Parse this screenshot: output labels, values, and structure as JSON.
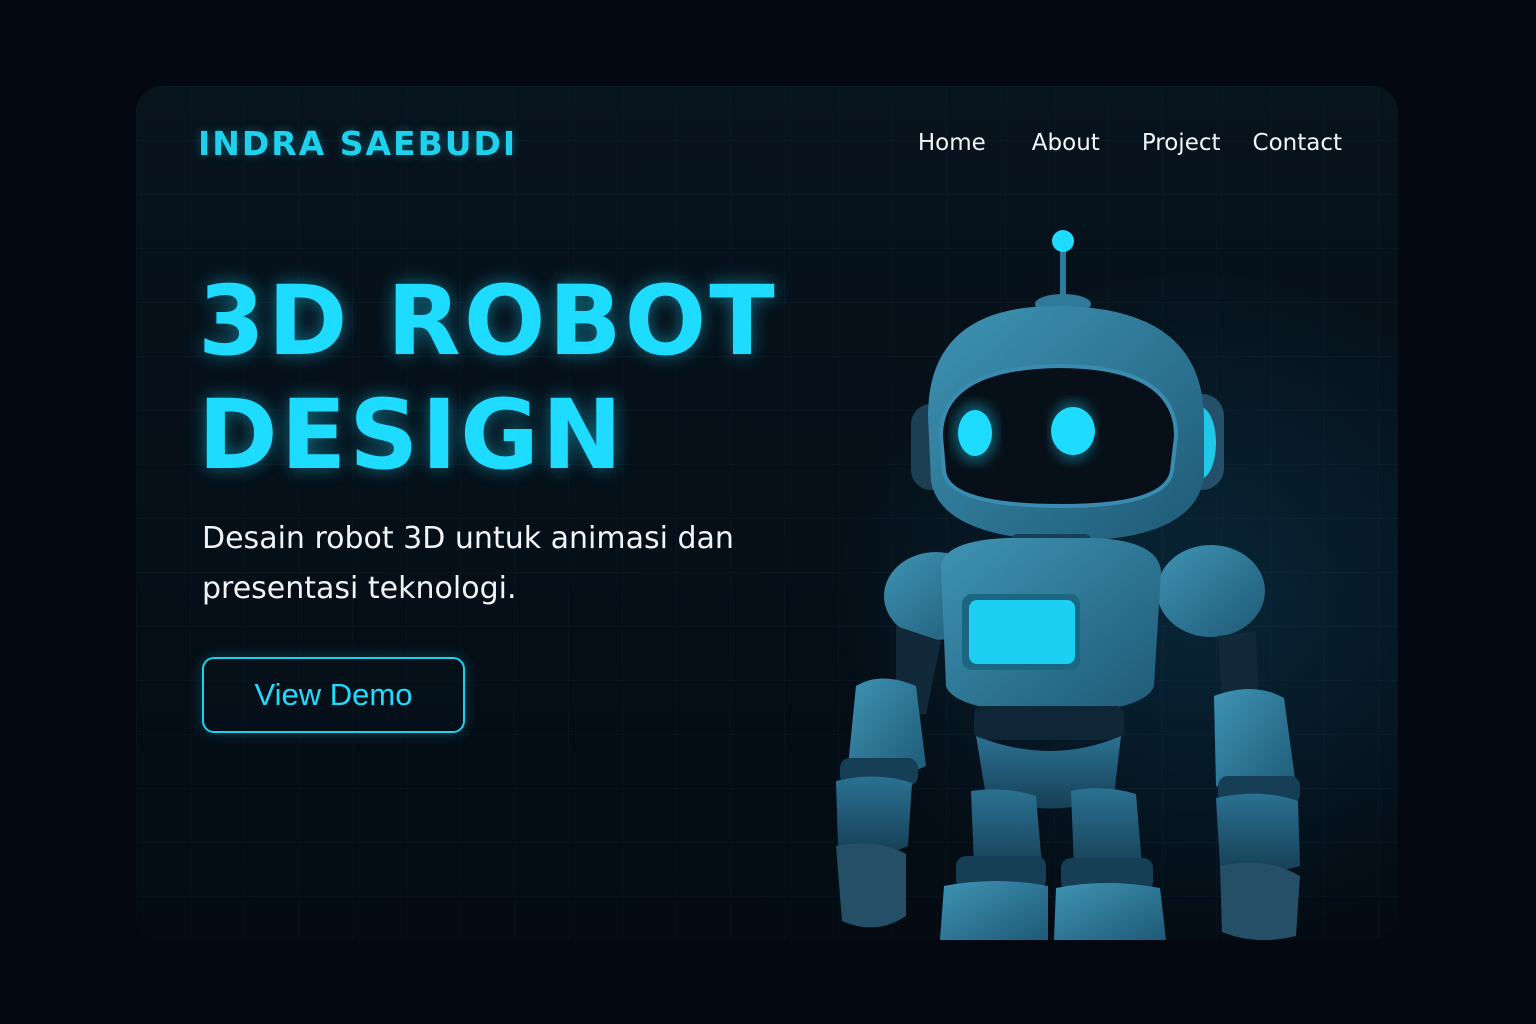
{
  "brand": {
    "name": "INDRA SAEBUDI"
  },
  "nav": {
    "items": [
      "Home",
      "About",
      "Project",
      "Contact"
    ]
  },
  "hero": {
    "title_line1": "3D ROBOT",
    "title_line2": "DESIGN",
    "subtitle": "Desain robot 3D untuk animasi dan presentasi teknologi.",
    "cta_label": "View Demo"
  },
  "colors": {
    "accent": "#1edcff",
    "background": "#030812",
    "panel": "#07131d",
    "robot_body": "#2f7a9a",
    "text": "#f1f4f6"
  },
  "illustration": {
    "subject": "robot-illustration"
  }
}
